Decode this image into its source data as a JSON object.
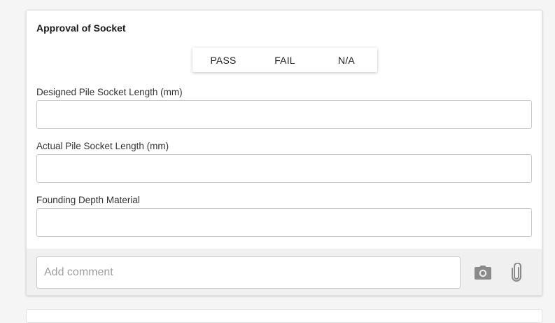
{
  "section": {
    "title": "Approval of Socket"
  },
  "segmented": {
    "options": [
      "PASS",
      "FAIL",
      "N/A"
    ]
  },
  "fields": [
    {
      "label": "Designed Pile Socket Length (mm)",
      "value": ""
    },
    {
      "label": "Actual Pile Socket Length (mm)",
      "value": ""
    },
    {
      "label": "Founding Depth Material",
      "value": ""
    }
  ],
  "comment": {
    "placeholder": "Add comment",
    "value": ""
  },
  "icons": {
    "camera": "camera-icon",
    "attach": "paperclip-icon"
  },
  "colors": {
    "icon": "#8a8a8a",
    "footer_bg": "#f0f0f0"
  }
}
